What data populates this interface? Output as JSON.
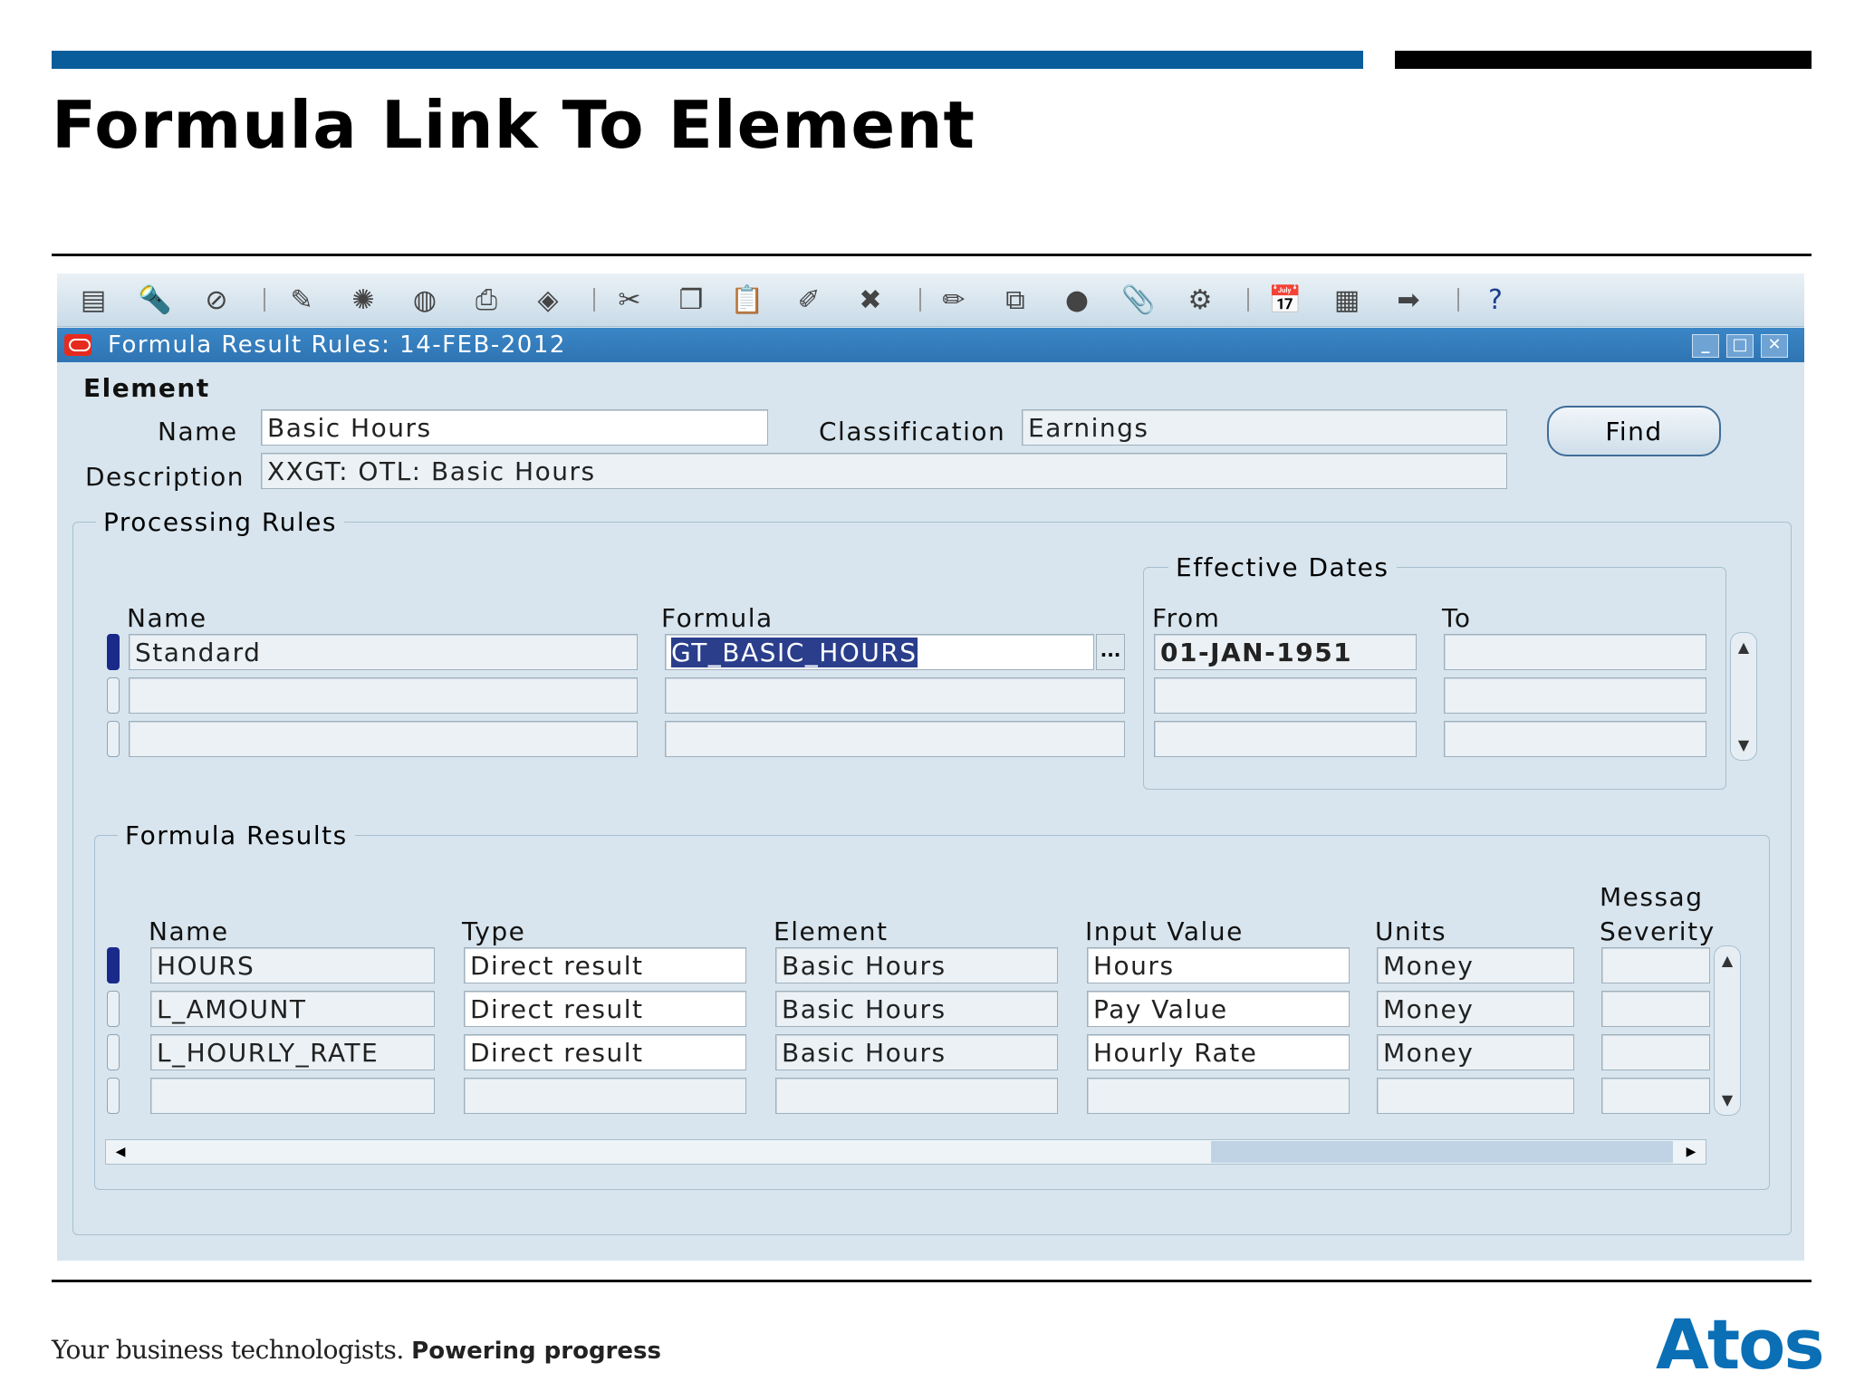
{
  "slide": {
    "title": "Formula Link To Element",
    "tagline_regular": "Your business technologists.",
    "tagline_bold": "Powering progress",
    "logo": "Atos"
  },
  "toolbar": {
    "icons": [
      "new-icon",
      "find-icon",
      "navigator-icon",
      "save-icon",
      "next-step-icon",
      "switch-responsibility-icon",
      "print-icon",
      "close-form-icon",
      "cut-icon",
      "copy-icon",
      "paste-icon",
      "clear-record-icon",
      "delete-icon",
      "edit-field-icon",
      "zoom-icon",
      "translations-icon",
      "attachments-icon",
      "folder-tools-icon",
      "calendar-icon",
      "window-icon",
      "navigate-icon",
      "help-icon"
    ]
  },
  "window": {
    "title": "Formula Result Rules: 14-FEB-2012"
  },
  "element": {
    "section_label": "Element",
    "name_label": "Name",
    "name_value": "Basic Hours",
    "classification_label": "Classification",
    "classification_value": "Earnings",
    "description_label": "Description",
    "description_value": "XXGT: OTL: Basic Hours",
    "find_label": "Find"
  },
  "processing_rules": {
    "title": "Processing Rules",
    "effective_dates_title": "Effective Dates",
    "headers": {
      "name": "Name",
      "formula": "Formula",
      "from": "From",
      "to": "To"
    },
    "rows": [
      {
        "name": "Standard",
        "formula": "GT_BASIC_HOURS",
        "from": "01-JAN-1951",
        "to": ""
      },
      {
        "name": "",
        "formula": "",
        "from": "",
        "to": ""
      },
      {
        "name": "",
        "formula": "",
        "from": "",
        "to": ""
      }
    ],
    "lov_label": "..."
  },
  "formula_results": {
    "title": "Formula Results",
    "headers": {
      "name": "Name",
      "type": "Type",
      "element": "Element",
      "input_value": "Input Value",
      "units": "Units",
      "message_line1": "Messag",
      "message_line2": "Severity"
    },
    "rows": [
      {
        "name": "HOURS",
        "type": "Direct result",
        "element": "Basic Hours",
        "input_value": "Hours",
        "units": "Money",
        "severity": ""
      },
      {
        "name": "L_AMOUNT",
        "type": "Direct result",
        "element": "Basic Hours",
        "input_value": "Pay Value",
        "units": "Money",
        "severity": ""
      },
      {
        "name": "L_HOURLY_RATE",
        "type": "Direct result",
        "element": "Basic Hours",
        "input_value": "Hourly Rate",
        "units": "Money",
        "severity": ""
      },
      {
        "name": "",
        "type": "",
        "element": "",
        "input_value": "",
        "units": "",
        "severity": ""
      }
    ]
  }
}
